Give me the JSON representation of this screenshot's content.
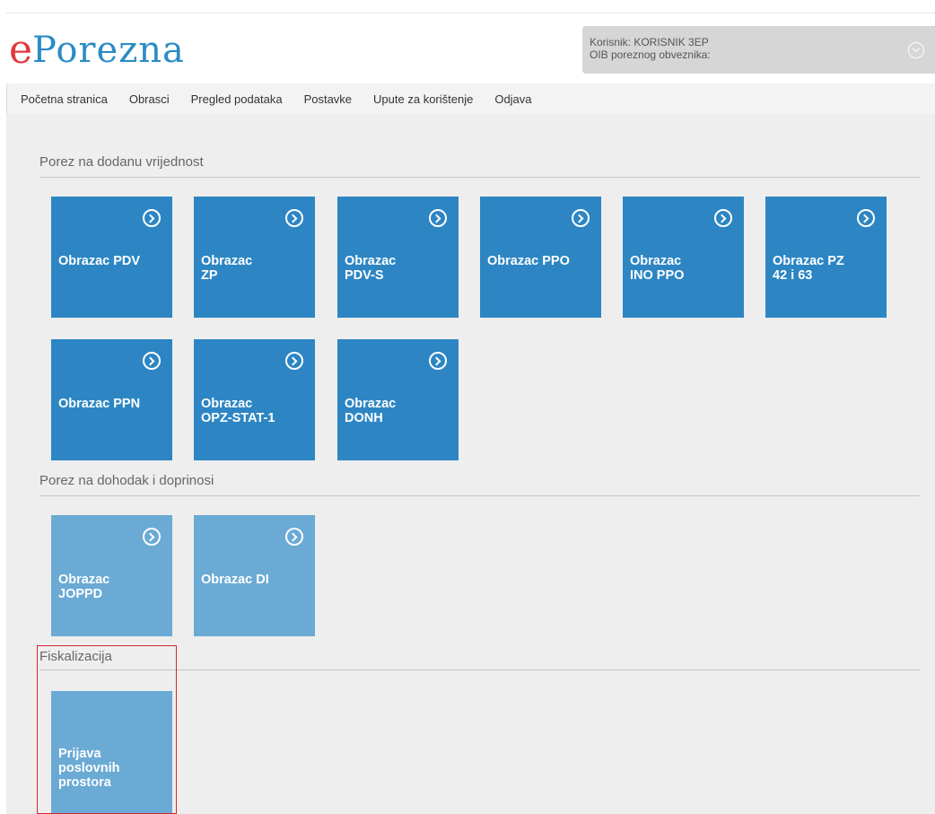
{
  "logo": {
    "e": "e",
    "rest": "Porezna"
  },
  "user": {
    "line1": "Korisnik: KORISNIK 3EP",
    "line2": "OIB poreznog obveznika:"
  },
  "nav": [
    "Početna stranica",
    "Obrasci",
    "Pregled podataka",
    "Postavke",
    "Upute za korištenje",
    "Odjava"
  ],
  "sections": {
    "pdv": {
      "title": "Porez na dodanu vrijednost",
      "tiles": [
        "Obrazac PDV",
        "Obrazac\nZP",
        "Obrazac\nPDV-S",
        "Obrazac PPO",
        "Obrazac\nINO PPO",
        "Obrazac PZ\n42 i 63",
        "Obrazac PPN",
        "Obrazac\nOPZ-STAT-1",
        "Obrazac\nDONH"
      ]
    },
    "dohodak": {
      "title": "Porez na dohodak i doprinosi",
      "tiles": [
        "Obrazac\nJOPPD",
        "Obrazac DI"
      ]
    },
    "fiskal": {
      "title": "Fiskalizacija",
      "tiles": [
        "Prijava\nposlovnih\nprostora"
      ]
    }
  },
  "colors": {
    "tile_dark": "#2d86c3",
    "tile_light": "#6aaad5",
    "logo_red": "#e03a3e",
    "logo_blue": "#2b8cc4",
    "highlight": "#d9262c"
  }
}
